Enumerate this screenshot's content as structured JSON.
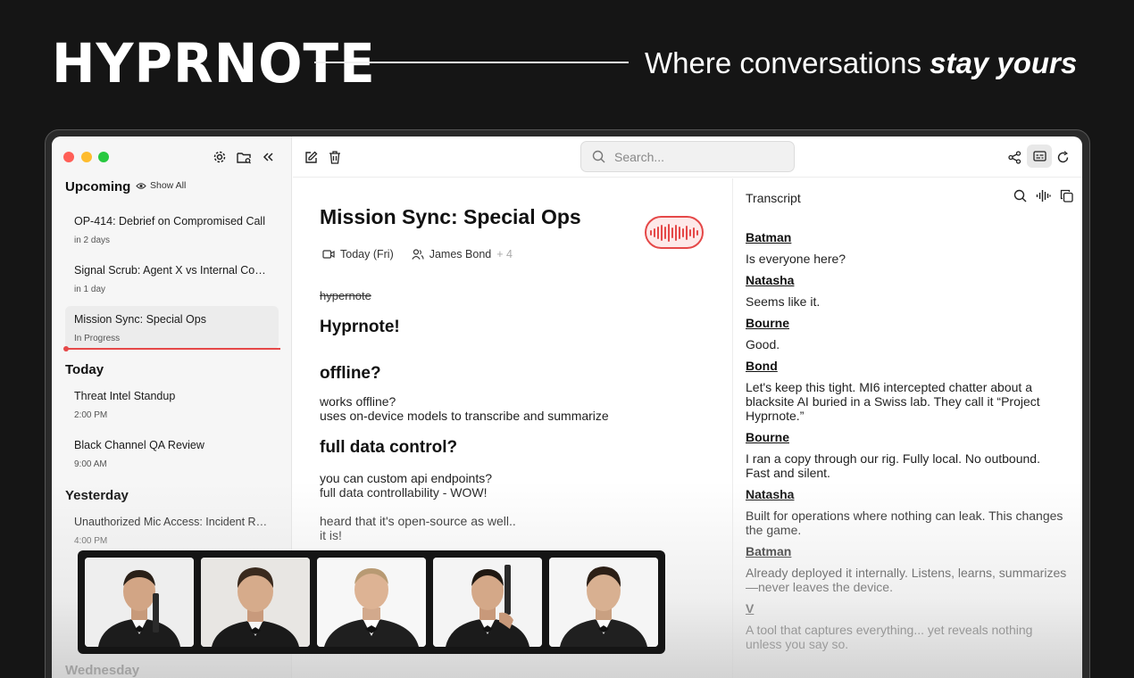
{
  "hero": {
    "brand": "HYPRNOTE",
    "tagline_plain": "Where conversations ",
    "tagline_bold": "stay yours"
  },
  "sidebar": {
    "sections": {
      "upcoming": "Upcoming",
      "show_all": "Show All",
      "today": "Today",
      "yesterday": "Yesterday",
      "wednesday": "Wednesday"
    },
    "upcoming": [
      {
        "title": "OP-414: Debrief on Compromised Call",
        "sub": "in 2 days"
      },
      {
        "title": "Signal Scrub: Agent X vs Internal Coun...",
        "sub": "in 1 day"
      },
      {
        "title": "Mission Sync: Special Ops",
        "sub": "In Progress"
      }
    ],
    "today": [
      {
        "title": "Threat Intel Standup",
        "sub": "2:00 PM"
      },
      {
        "title": "Black Channel QA Review",
        "sub": "9:00 AM"
      }
    ],
    "yesterday": [
      {
        "title": "Unauthorized Mic Access: Incident Re...",
        "sub": "4:00 PM"
      }
    ]
  },
  "toolbar": {
    "search_placeholder": "Search..."
  },
  "note": {
    "title": "Mission Sync: Special Ops",
    "date": "Today (Fri)",
    "participant": "James Bond",
    "participant_more": "+ 4",
    "strike": "hypernote",
    "heading1": "Hyprnote!",
    "heading2": "offline?",
    "p1_line1": "works offline?",
    "p1_line2": "uses on-device models to transcribe and summarize",
    "heading3": "full data control?",
    "p2_line1": "you can custom api endpoints?",
    "p2_line2": "full data controllability - WOW!",
    "p3_line1": "heard that it's open-source as well..",
    "p3_line2": "it is!"
  },
  "transcript": {
    "title": "Transcript",
    "entries": [
      {
        "speaker": "Batman",
        "text": "Is everyone here?"
      },
      {
        "speaker": "Natasha",
        "text": "Seems like it."
      },
      {
        "speaker": "Bourne",
        "text": "Good."
      },
      {
        "speaker": "Bond",
        "text": "Let's keep this tight. MI6 intercepted chatter about a blacksite AI buried in a Swiss lab. They call it “Project Hyprnote.”"
      },
      {
        "speaker": "Bourne",
        "text": "I ran a copy through our rig. Fully local. No outbound. Fast and silent."
      },
      {
        "speaker": "Natasha",
        "text": "Built for operations where nothing can leak. This changes the game."
      },
      {
        "speaker": "Batman",
        "text": "Already deployed it internally. Listens, learns, summarizes—never leaves the device."
      },
      {
        "speaker": "V",
        "text": "A tool that captures everything... yet reveals nothing unless you say so."
      }
    ]
  },
  "photos": [
    "agent-portrait-1",
    "agent-portrait-2",
    "agent-portrait-3",
    "agent-portrait-4",
    "agent-portrait-5"
  ],
  "colors": {
    "accent_red": "#e54848",
    "background": "#151515"
  }
}
